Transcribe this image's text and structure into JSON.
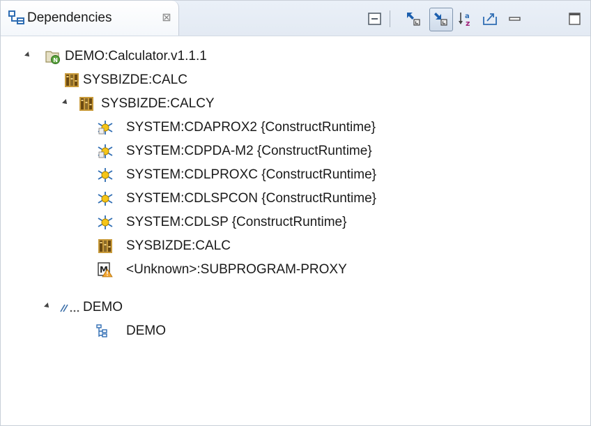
{
  "view": {
    "title": "Dependencies",
    "close_glyph": "⊠",
    "toolbar": [
      {
        "name": "collapse-all-icon"
      },
      {
        "name": "show-callers-icon"
      },
      {
        "name": "show-callees-icon"
      },
      {
        "name": "sort-alphabetically-icon"
      },
      {
        "name": "export-icon"
      },
      {
        "name": "minimize-icon"
      },
      {
        "name": "maximize-icon"
      }
    ]
  },
  "tree": {
    "root": {
      "label": "DEMO:Calculator.v1.1.1",
      "icon": "natural-project-icon"
    },
    "items": [
      {
        "label": "SYSBIZDE:CALC",
        "icon": "library-icon"
      },
      {
        "label": "SYSBIZDE:CALCY",
        "icon": "library-icon"
      },
      {
        "label": "SYSTEM:CDAPROX2 {ConstructRuntime}",
        "icon": "runtime-object-icon"
      },
      {
        "label": "SYSTEM:CDPDA-M2 {ConstructRuntime}",
        "icon": "runtime-object-icon"
      },
      {
        "label": "SYSTEM:CDLPROXC {ConstructRuntime}",
        "icon": "runtime-object-icon"
      },
      {
        "label": "SYSTEM:CDLSPCON {ConstructRuntime}",
        "icon": "runtime-object-icon"
      },
      {
        "label": "SYSTEM:CDLSP {ConstructRuntime}",
        "icon": "runtime-object-icon"
      },
      {
        "label": "SYSBIZDE:CALC",
        "icon": "library-icon"
      },
      {
        "label": "<Unknown>:SUBPROGRAM-PROXY",
        "icon": "module-warning-icon"
      },
      {
        "label": "DEMO",
        "icon": "server-icon"
      },
      {
        "label": "DEMO",
        "icon": "hierarchy-icon"
      }
    ]
  },
  "colors": {
    "tab_bg": "#eaf0f8",
    "accent": "#2f6db3",
    "selected_button": "#cfdbea"
  }
}
